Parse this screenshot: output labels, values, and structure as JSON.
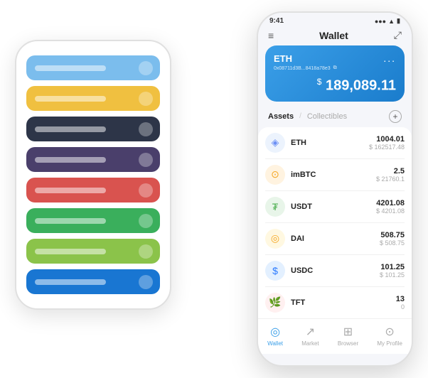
{
  "scene": {
    "bg_phone": {
      "cards": [
        {
          "color": "#7bbded",
          "text_color": "rgba(255,255,255,0.5)"
        },
        {
          "color": "#f0c040",
          "text_color": "rgba(255,255,255,0.5)"
        },
        {
          "color": "#2d3548",
          "text_color": "rgba(255,255,255,0.5)"
        },
        {
          "color": "#4a3f6b",
          "text_color": "rgba(255,255,255,0.5)"
        },
        {
          "color": "#d9534f",
          "text_color": "rgba(255,255,255,0.5)"
        },
        {
          "color": "#3aaf5c",
          "text_color": "rgba(255,255,255,0.5)"
        },
        {
          "color": "#8bc34a",
          "text_color": "rgba(255,255,255,0.5)"
        },
        {
          "color": "#1976d2",
          "text_color": "rgba(255,255,255,0.5)"
        }
      ]
    },
    "fg_phone": {
      "status_bar": {
        "time": "9:41",
        "signal": "●●●",
        "wifi": "▲",
        "battery": "▮"
      },
      "header": {
        "menu_icon": "≡",
        "title": "Wallet",
        "expand_icon": "⤢"
      },
      "eth_card": {
        "name": "ETH",
        "address": "0x08711d3B...8418a78e3",
        "copy_icon": "⧉",
        "more_icon": "...",
        "balance_prefix": "$",
        "balance": "189,089.11"
      },
      "assets_section": {
        "tab_active": "Assets",
        "tab_divider": "/",
        "tab_inactive": "Collectibles",
        "add_icon": "+"
      },
      "tokens": [
        {
          "symbol": "ETH",
          "icon_emoji": "◈",
          "icon_class": "eth-icon",
          "amount": "1004.01",
          "usd": "$ 162517.48"
        },
        {
          "symbol": "imBTC",
          "icon_emoji": "⊙",
          "icon_class": "imbtc-icon",
          "amount": "2.5",
          "usd": "$ 21760.1"
        },
        {
          "symbol": "USDT",
          "icon_emoji": "₮",
          "icon_class": "usdt-icon",
          "amount": "4201.08",
          "usd": "$ 4201.08"
        },
        {
          "symbol": "DAI",
          "icon_emoji": "◎",
          "icon_class": "dai-icon",
          "amount": "508.75",
          "usd": "$ 508.75"
        },
        {
          "symbol": "USDC",
          "icon_emoji": "$",
          "icon_class": "usdc-icon",
          "amount": "101.25",
          "usd": "$ 101.25"
        },
        {
          "symbol": "TFT",
          "icon_emoji": "🌿",
          "icon_class": "tft-icon",
          "amount": "13",
          "usd": "0"
        }
      ],
      "bottom_nav": [
        {
          "label": "Wallet",
          "icon": "◎",
          "active": true
        },
        {
          "label": "Market",
          "icon": "📈",
          "active": false
        },
        {
          "label": "Browser",
          "icon": "🌐",
          "active": false
        },
        {
          "label": "My Profile",
          "icon": "👤",
          "active": false
        }
      ]
    }
  }
}
